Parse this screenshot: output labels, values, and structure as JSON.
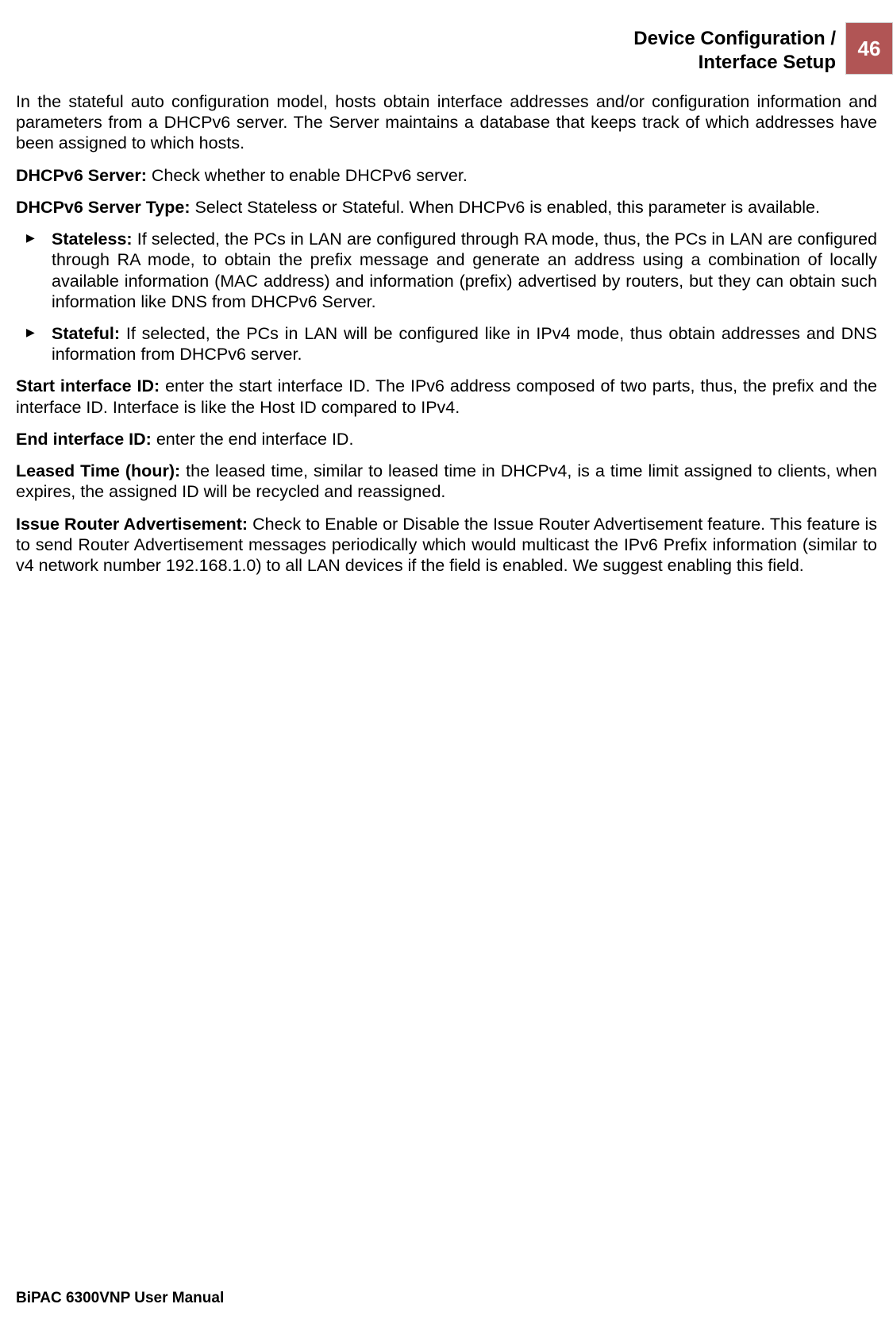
{
  "header": {
    "title_line1": "Device Configuration /",
    "title_line2": "Interface Setup",
    "page_number": "46"
  },
  "body": {
    "p1": "In the stateful auto configuration model, hosts obtain interface addresses and/or configuration information and parameters from a DHCPv6 server. The Server maintains a database that keeps track of which addresses have been assigned to which hosts.",
    "p2_label": "DHCPv6 Server:",
    "p2_text": " Check whether to enable DHCPv6 server.",
    "p3_label": "DHCPv6 Server Type:",
    "p3_text": " Select Stateless or Stateful. When DHCPv6 is enabled, this parameter is available.",
    "bullets": [
      {
        "label": "Stateless:",
        "text": " If selected, the PCs in LAN are configured through RA mode, thus,  the PCs in LAN are configured through RA mode, to obtain the prefix message and generate an address using a combination of locally available information (MAC address) and information (prefix) advertised by routers, but they can obtain such information like DNS from DHCPv6 Server."
      },
      {
        "label": "Stateful:",
        "text": " If selected, the PCs in LAN will be configured like in IPv4 mode, thus obtain addresses and DNS information from DHCPv6 server."
      }
    ],
    "p4_label": "Start interface ID:",
    "p4_text": " enter the start interface ID. The IPv6 address composed of two parts, thus, the prefix and the interface ID. Interface is like the Host ID compared to IPv4.",
    "p5_label": "End interface ID:",
    "p5_text": " enter the end interface ID.",
    "p6_label": "Leased Time (hour):",
    "p6_text": " the leased time, similar to leased time in DHCPv4, is a time limit assigned to clients, when expires, the assigned ID will be recycled and reassigned.",
    "p7_label": "Issue Router Advertisement:",
    "p7_text": " Check to Enable or Disable the Issue Router Advertisement feature. This feature is to send Router Advertisement messages periodically which would multicast the IPv6 Prefix information (similar to v4 network number 192.168.1.0) to all LAN devices if the field is enabled. We suggest enabling this field."
  },
  "footer": {
    "text": "BiPAC 6300VNP User Manual"
  }
}
